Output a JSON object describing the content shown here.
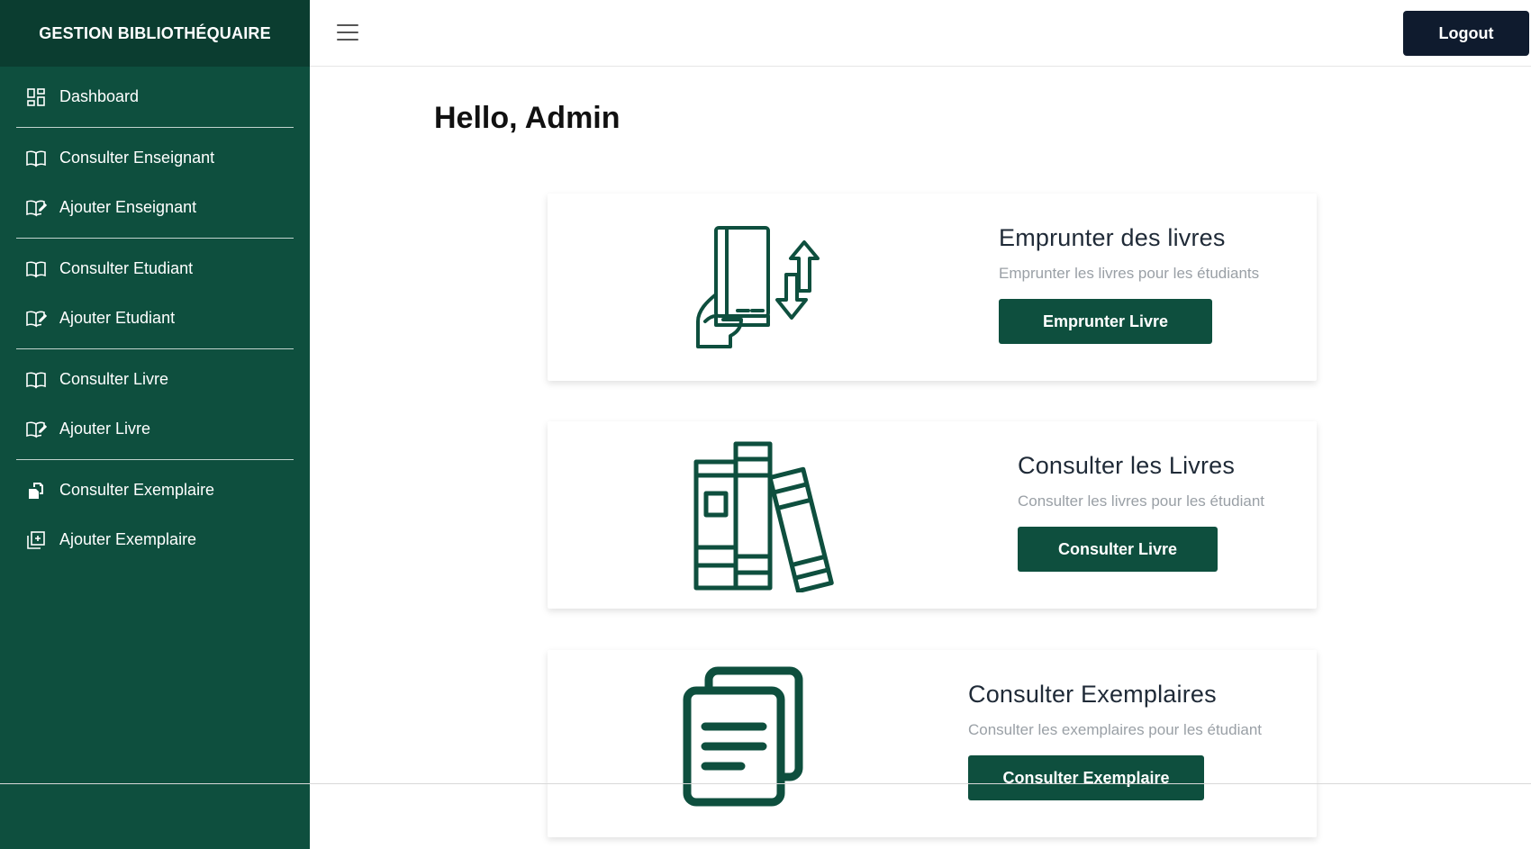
{
  "sidebar": {
    "brand": "GESTION BIBLIOTHÉQUAIRE",
    "groups": [
      {
        "items": [
          {
            "label": "Dashboard",
            "icon": "dashboard-icon"
          }
        ]
      },
      {
        "items": [
          {
            "label": "Consulter Enseignant",
            "icon": "book-open-icon"
          },
          {
            "label": "Ajouter Enseignant",
            "icon": "book-edit-icon"
          }
        ]
      },
      {
        "items": [
          {
            "label": "Consulter Etudiant",
            "icon": "book-open-icon"
          },
          {
            "label": "Ajouter Etudiant",
            "icon": "book-edit-icon"
          }
        ]
      },
      {
        "items": [
          {
            "label": "Consulter Livre",
            "icon": "book-open-icon"
          },
          {
            "label": "Ajouter Livre",
            "icon": "book-edit-icon"
          }
        ]
      },
      {
        "items": [
          {
            "label": "Consulter Exemplaire",
            "icon": "copies-icon"
          },
          {
            "label": "Ajouter Exemplaire",
            "icon": "add-copy-icon"
          }
        ]
      }
    ]
  },
  "topbar": {
    "logout_label": "Logout",
    "menu_icon": "hamburger-icon"
  },
  "main": {
    "greeting": "Hello, Admin",
    "cards": [
      {
        "title": "Emprunter des livres",
        "description": "Emprunter les livres pour les étudiants",
        "button": "Emprunter Livre",
        "icon": "borrow-book-icon"
      },
      {
        "title": "Consulter les Livres",
        "description": "Consulter les livres pour les étudiant",
        "button": "Consulter Livre",
        "icon": "books-shelf-icon"
      },
      {
        "title": "Consulter Exemplaires",
        "description": "Consulter les exemplaires pour les étudiant",
        "button": "Consulter Exemplaire",
        "icon": "documents-icon"
      }
    ]
  },
  "colors": {
    "sidebar": "#0e4f3e",
    "brand_bar": "#0b3d30",
    "logout": "#0f1b2e",
    "accent": "#0e4f3e"
  }
}
